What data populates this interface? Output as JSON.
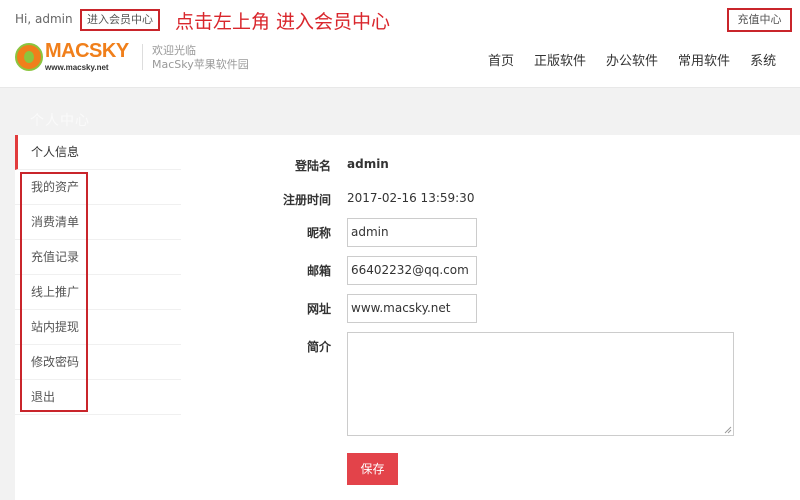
{
  "topbar": {
    "greeting": "Hi, admin",
    "member_center_link": "进入会员中心",
    "annotation": "点击左上角 进入会员中心",
    "recharge_center_link": "充值中心"
  },
  "header": {
    "logo_text": "MACSKY",
    "logo_url_text": "www.macsky.net",
    "welcome_line1": "欢迎光临",
    "welcome_line2": "MacSky苹果软件园",
    "nav": [
      "首页",
      "正版软件",
      "办公软件",
      "常用软件",
      "系统"
    ]
  },
  "banner": {
    "title": "个人中心"
  },
  "sidebar": {
    "items": [
      {
        "label": "个人信息",
        "active": true
      },
      {
        "label": "我的资产"
      },
      {
        "label": "消费清单"
      },
      {
        "label": "充值记录"
      },
      {
        "label": "线上推广"
      },
      {
        "label": "站内提现"
      },
      {
        "label": "修改密码"
      },
      {
        "label": "退出"
      }
    ]
  },
  "profile": {
    "login_name_label": "登陆名",
    "login_name_value": "admin",
    "register_time_label": "注册时间",
    "register_time_value": "2017-02-16 13:59:30",
    "nickname_label": "昵称",
    "nickname_value": "admin",
    "email_label": "邮箱",
    "email_value": "66402232@qq.com",
    "website_label": "网址",
    "website_value": "www.macsky.net",
    "bio_label": "简介",
    "bio_value": "",
    "save_button": "保存"
  },
  "colors": {
    "accent": "#e3434a",
    "annotation_red": "#d9262c",
    "logo_orange": "#f07f1b",
    "logo_green": "#8bc53f",
    "page_bg": "#f2f2f2"
  }
}
